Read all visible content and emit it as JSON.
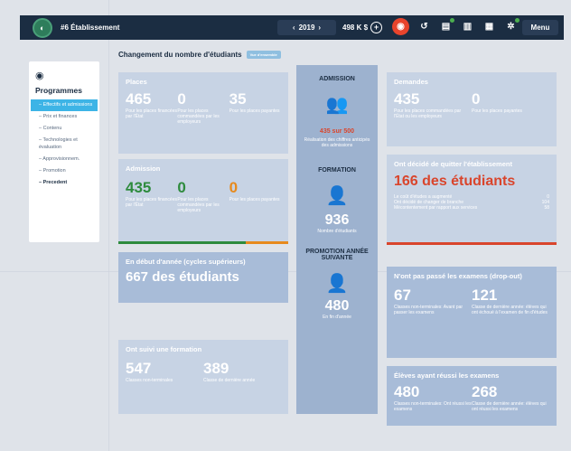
{
  "header": {
    "title": "#6 Établissement",
    "year_prev": "‹",
    "year": "2019",
    "year_next": "›",
    "money": "498 K $",
    "lang": "Fr",
    "menu": "Menu"
  },
  "sidebar": {
    "heading": "Programmes",
    "items": [
      "Effectifs et admissions",
      "Prix et finances",
      "Contenu",
      "Technologies et évaluation",
      "Approvisionnem.",
      "Promotion",
      "Precedent"
    ]
  },
  "section": {
    "title": "Changement du nombre d'étudiants",
    "badge": "Vue d'ensemble"
  },
  "places": {
    "title": "Places",
    "cols": [
      {
        "num": "465",
        "text": "Pour les places financées par l'État"
      },
      {
        "num": "0",
        "text": "Pour les places commandées par les employeurs"
      },
      {
        "num": "35",
        "text": "Pour les places payantes"
      }
    ]
  },
  "admission_card": {
    "title": "Admission",
    "cols": [
      {
        "num": "435",
        "text": "Pour les places financées par l'État"
      },
      {
        "num": "0",
        "text": "Pour les places commandées par les employeurs"
      },
      {
        "num": "0",
        "text": "Pour les places payantes"
      }
    ]
  },
  "debut": {
    "title": "En début d'année (cycles supérieurs)",
    "value": "667 des étudiants"
  },
  "formation_suivie": {
    "title": "Ont suivi une formation",
    "cols": [
      {
        "num": "547",
        "text": "Classes non-terminales"
      },
      {
        "num": "389",
        "text": "Classe de dernière année"
      }
    ]
  },
  "middle": {
    "admission_t": "ADMISSION",
    "admission_v": "435 sur 500",
    "admission_s": "Réalisation des chiffres anticipés des admissions",
    "formation_t": "FORMATION",
    "formation_v": "936",
    "formation_s": "Nombre d'étudiants",
    "promo_t": "PROMOTION ANNÉE SUIVANTE",
    "promo_v": "480",
    "promo_s": "En fin d'année"
  },
  "demandes": {
    "title": "Demandes",
    "cols": [
      {
        "num": "435",
        "text": "Pour les places commandées par l'État ou les employeurs"
      },
      {
        "num": "0",
        "text": "Pour les places payantes"
      }
    ]
  },
  "quitter": {
    "title": "Ont décidé de quitter l'établissement",
    "value": "166 des étudiants",
    "rows": [
      {
        "label": "Le coût d'études a augmenté",
        "v": "0"
      },
      {
        "label": "Ont décidé de changer de branche",
        "v": "104"
      },
      {
        "label": "Mécontentement par rapport aux services",
        "v": "58"
      }
    ]
  },
  "dropout": {
    "title": "N'ont pas passé les examens (drop-out)",
    "cols": [
      {
        "num": "67",
        "text": "Classes non-terminales: Avant par passer les examens"
      },
      {
        "num": "121",
        "text": "Classe de dernière année: élèves qui ont échoué à l'examen de fin d'études"
      }
    ]
  },
  "reussi": {
    "title": "Élèves ayant réussi les examens",
    "cols": [
      {
        "num": "480",
        "text": "Classes non-terminales: Ont réussi les examens"
      },
      {
        "num": "268",
        "text": "Classe de dernière année: élèves qui ont réussi les examens"
      }
    ]
  }
}
